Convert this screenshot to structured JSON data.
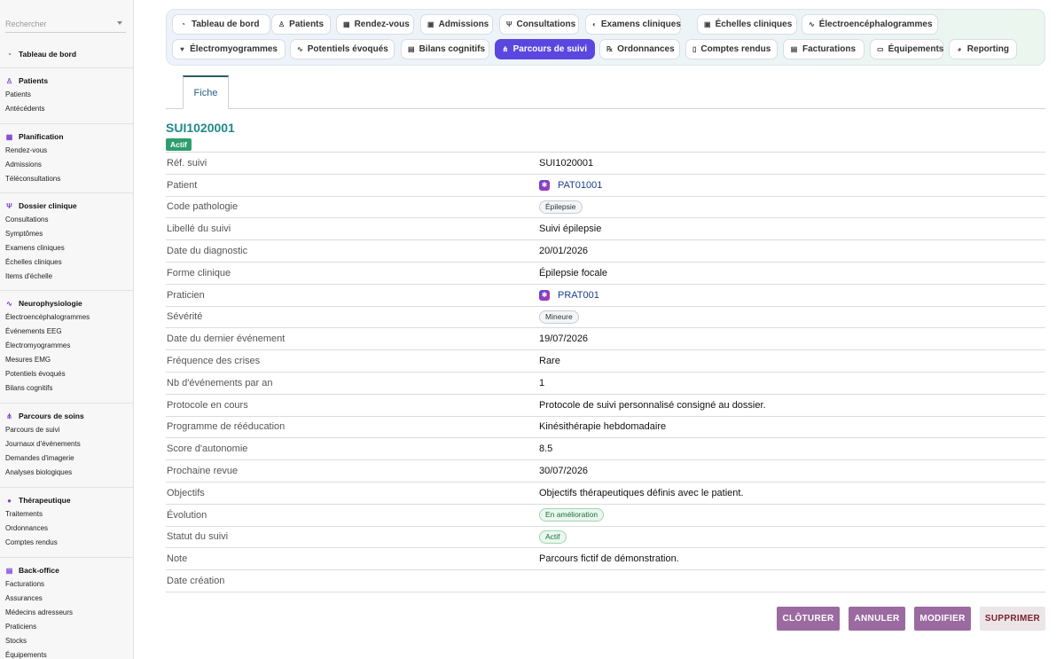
{
  "search": {
    "placeholder": "Rechercher"
  },
  "sidebar": {
    "sections": [
      {
        "title": "Tableau de bord",
        "icon": "dashboard-icon",
        "glyph": "◔",
        "items": []
      },
      {
        "title": "Patients",
        "icon": "person-icon",
        "glyph": "♙",
        "items": [
          "Patients",
          "Antécédents"
        ]
      },
      {
        "title": "Planification",
        "icon": "calendar-icon",
        "glyph": "▦",
        "items": [
          "Rendez-vous",
          "Admissions",
          "Téléconsultations"
        ]
      },
      {
        "title": "Dossier clinique",
        "icon": "stethoscope-icon",
        "glyph": "Ψ",
        "items": [
          "Consultations",
          "Symptômes",
          "Examens cliniques",
          "Échelles cliniques",
          "Items d'échelle"
        ]
      },
      {
        "title": "Neurophysiologie",
        "icon": "waveform-icon",
        "glyph": "∿",
        "items": [
          "Électroencéphalogrammes",
          "Événements EEG",
          "Électromyogrammes",
          "Mesures EMG",
          "Potentiels évoqués",
          "Bilans cognitifs"
        ]
      },
      {
        "title": "Parcours de soins",
        "icon": "flow-icon",
        "glyph": "⋔",
        "items": [
          "Parcours de suivi",
          "Journaux d'événements",
          "Demandes d'imagerie",
          "Analyses biologiques"
        ]
      },
      {
        "title": "Thérapeutique",
        "icon": "pills-icon",
        "glyph": "●",
        "items": [
          "Traitements",
          "Ordonnances",
          "Comptes rendus"
        ]
      },
      {
        "title": "Back-office",
        "icon": "building-icon",
        "glyph": "▤",
        "items": [
          "Facturations",
          "Assurances",
          "Médecins adresseurs",
          "Praticiens",
          "Stocks",
          "Équipements"
        ]
      }
    ]
  },
  "topnav": {
    "tabs": [
      {
        "label": "Tableau de bord",
        "icon": "dashboard-icon",
        "glyph": "◔"
      },
      {
        "label": "Patients",
        "icon": "person-icon",
        "glyph": "♙"
      },
      {
        "label": "Rendez-vous",
        "icon": "calendar-icon",
        "glyph": "▦"
      },
      {
        "label": "Admissions",
        "icon": "clipboard-icon",
        "glyph": "▣"
      },
      {
        "label": "Consultations",
        "icon": "stethoscope-icon",
        "glyph": "Ψ"
      },
      {
        "label": "Examens cliniques",
        "icon": "lungs-icon",
        "glyph": "◐"
      },
      {
        "label": "Échelles cliniques",
        "icon": "scale-icon",
        "glyph": "▣"
      },
      {
        "label": "Électroencéphalogrammes",
        "icon": "waveform-icon",
        "glyph": "∿"
      },
      {
        "label": "Électromyogrammes",
        "icon": "heart-pulse-icon",
        "glyph": "♥"
      },
      {
        "label": "Potentiels évoqués",
        "icon": "waveform-icon",
        "glyph": "∿"
      },
      {
        "label": "Bilans cognitifs",
        "icon": "book-icon",
        "glyph": "▤"
      },
      {
        "label": "Parcours de suivi",
        "icon": "flow-icon",
        "glyph": "⋔"
      },
      {
        "label": "Ordonnances",
        "icon": "prescription-icon",
        "glyph": "℞"
      },
      {
        "label": "Comptes rendus",
        "icon": "file-icon",
        "glyph": "▯"
      },
      {
        "label": "Facturations",
        "icon": "invoice-icon",
        "glyph": "▤"
      },
      {
        "label": "Équipements",
        "icon": "monitor-icon",
        "glyph": "▭"
      },
      {
        "label": "Reporting",
        "icon": "pie-chart-icon",
        "glyph": "◕"
      }
    ],
    "active_index": 11
  },
  "detail_tab": "Fiche",
  "record": {
    "title": "SUI1020001",
    "status_badge": "Actif",
    "fields": [
      {
        "label": "Réf. suivi",
        "value": "SUI1020001",
        "kind": "text"
      },
      {
        "label": "Patient",
        "value": "PAT01001",
        "kind": "link"
      },
      {
        "label": "Code pathologie",
        "value": "Épilepsie",
        "kind": "pill"
      },
      {
        "label": "Libellé du suivi",
        "value": "Suivi épilepsie",
        "kind": "text"
      },
      {
        "label": "Date du diagnostic",
        "value": "20/01/2026",
        "kind": "text"
      },
      {
        "label": "Forme clinique",
        "value": "Épilepsie focale",
        "kind": "text"
      },
      {
        "label": "Praticien",
        "value": "PRAT001",
        "kind": "link"
      },
      {
        "label": "Sévérité",
        "value": "Mineure",
        "kind": "pill"
      },
      {
        "label": "Date du dernier événement",
        "value": "19/07/2026",
        "kind": "text"
      },
      {
        "label": "Fréquence des crises",
        "value": "Rare",
        "kind": "text"
      },
      {
        "label": "Nb d'événements par an",
        "value": "1",
        "kind": "text"
      },
      {
        "label": "Protocole en cours",
        "value": "Protocole de suivi personnalisé consigné au dossier.",
        "kind": "text"
      },
      {
        "label": "Programme de rééducation",
        "value": "Kinésithérapie hebdomadaire",
        "kind": "text"
      },
      {
        "label": "Score d'autonomie",
        "value": "8.5",
        "kind": "text"
      },
      {
        "label": "Prochaine revue",
        "value": "30/07/2026",
        "kind": "text"
      },
      {
        "label": "Objectifs",
        "value": "Objectifs thérapeutiques définis avec le patient.",
        "kind": "text"
      },
      {
        "label": "Évolution",
        "value": "En amélioration",
        "kind": "pill-green"
      },
      {
        "label": "Statut du suivi",
        "value": "Actif",
        "kind": "pill-green"
      },
      {
        "label": "Note",
        "value": "Parcours fictif de démonstration.",
        "kind": "text"
      },
      {
        "label": "Date création",
        "value": "",
        "kind": "text"
      }
    ]
  },
  "actions": {
    "close_label": "CLÔTURER",
    "cancel_label": "ANNULER",
    "edit_label": "MODIFIER",
    "delete_label": "SUPPRIMER"
  },
  "colors": {
    "accent": "#5b46e0",
    "title": "#1f8a8a",
    "badge_active": "#2f9e6e",
    "action_button": "#9b6aa0",
    "danger_text": "#7a1f2c"
  }
}
